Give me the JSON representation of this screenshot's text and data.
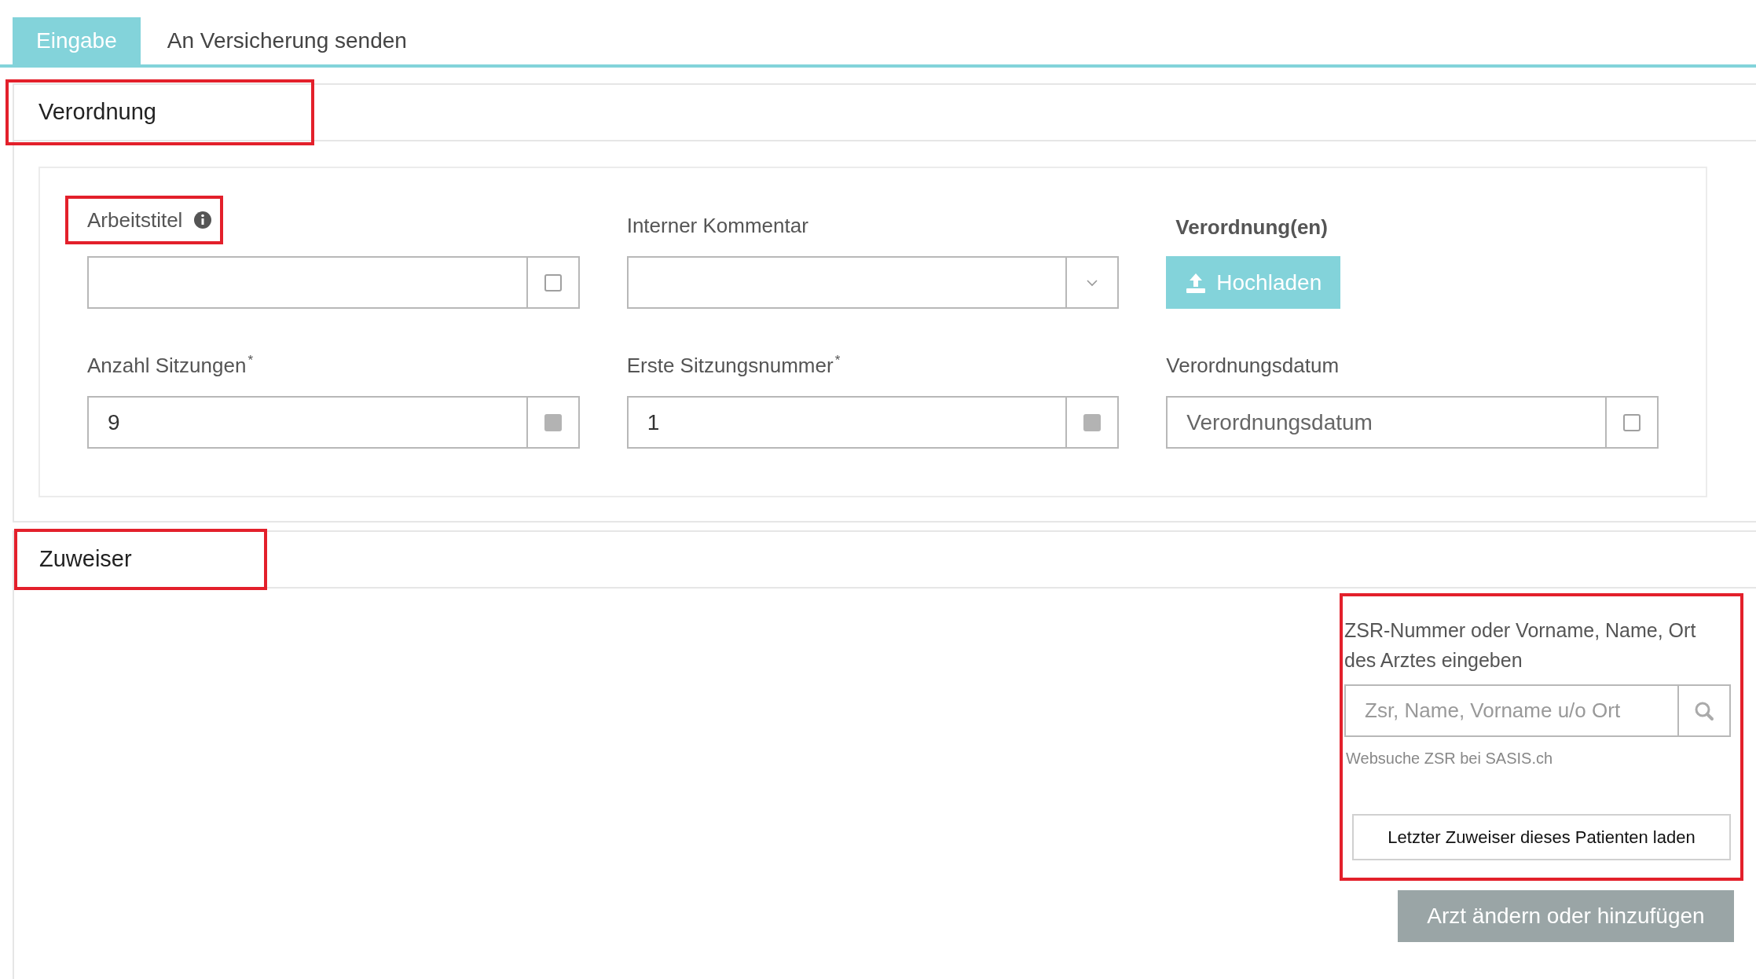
{
  "tabs": [
    {
      "label": "Eingabe",
      "selected": true
    },
    {
      "label": "An Versicherung senden",
      "selected": false
    }
  ],
  "verordnung": {
    "title": "Verordnung",
    "highlighted": true,
    "fields": [
      {
        "kind": "text",
        "label": "Arbeitstitel",
        "info": true,
        "highlighted": true,
        "addon": {
          "kind": "checkbox",
          "disabled": false
        }
      },
      {
        "kind": "select",
        "label": "Interner Kommentar",
        "addon": {
          "kind": "chevron"
        }
      },
      {
        "kind": "upload",
        "label": "Verordnung(en)",
        "button": "Hochladen"
      },
      {
        "kind": "text",
        "label": "Anzahl Sitzungen",
        "required_mark": "*",
        "value": "9",
        "addon": {
          "kind": "checkbox",
          "disabled": true
        }
      },
      {
        "kind": "text",
        "label": "Erste Sitzungsnummer",
        "required_mark": "*",
        "value": "1",
        "addon": {
          "kind": "checkbox",
          "disabled": true
        }
      },
      {
        "kind": "text",
        "label": "Verordnungsdatum",
        "placeholder": "Verordnungsdatum",
        "addon": {
          "kind": "checkbox",
          "disabled": false
        }
      }
    ]
  },
  "zuweiser": {
    "title": "Zuweiser",
    "highlighted": true,
    "search_block": {
      "highlighted": true,
      "instruction": "ZSR-Nummer oder Vorname, Name, Ort des Arztes eingeben",
      "placeholder": "Zsr, Name, Vorname u/o Ort",
      "link": "Websuche ZSR bei SASIS.ch",
      "load_button": "Letzter Zuweiser dieses Patienten laden"
    },
    "action_button": "Arzt ändern oder hinzufügen"
  }
}
